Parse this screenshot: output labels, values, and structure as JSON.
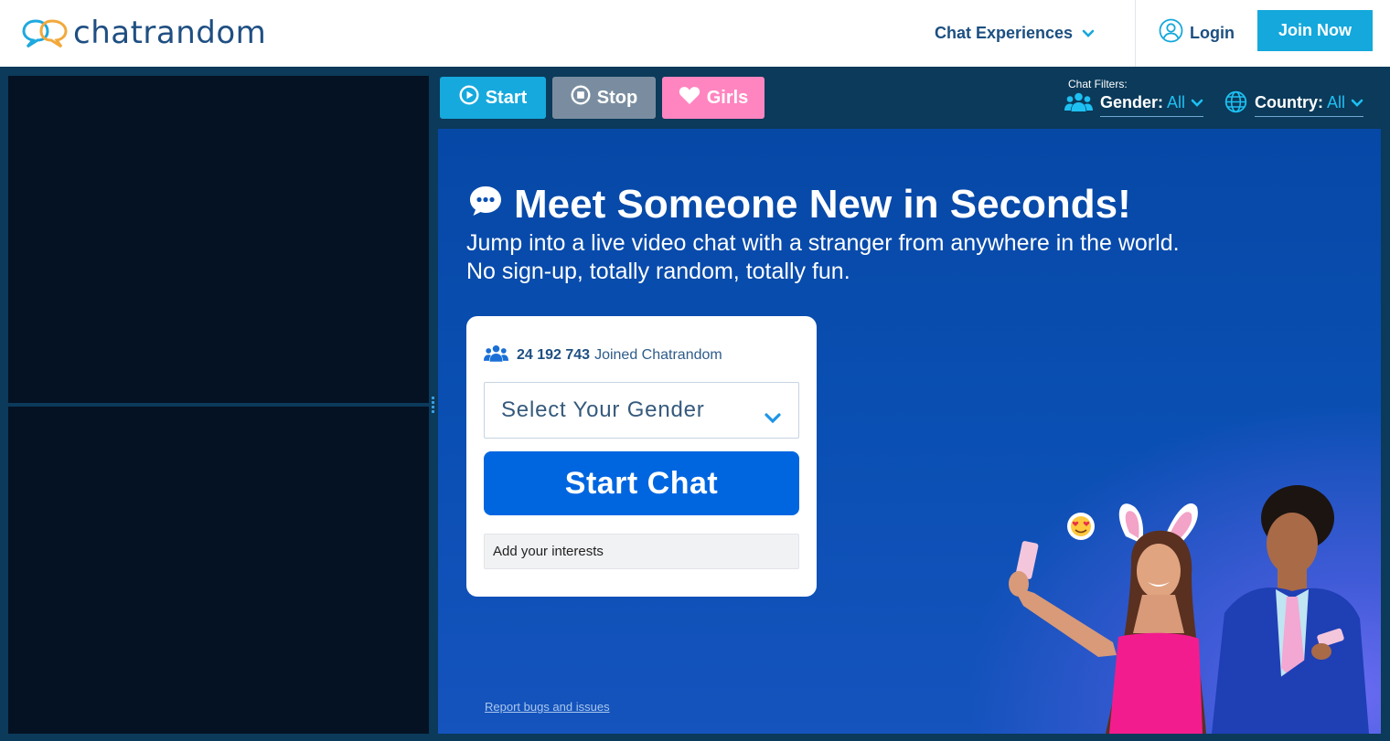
{
  "header": {
    "logo_text": "chatrandom",
    "nav_experiences": "Chat Experiences",
    "login": "Login",
    "join": "Join Now"
  },
  "toolbar": {
    "start": "Start",
    "stop": "Stop",
    "girls": "Girls",
    "filters_label": "Chat Filters:",
    "gender_key": "Gender:",
    "gender_value": "All",
    "country_key": "Country:",
    "country_value": "All"
  },
  "hero": {
    "title": "Meet Someone New in Seconds!",
    "subtitle": "Jump into a live video chat with a stranger from anywhere in the world. No sign-up, totally random, totally fun."
  },
  "card": {
    "joined_count": "24 192 743",
    "joined_text": "Joined Chatrandom",
    "gender_select": "Select Your Gender",
    "start_chat": "Start Chat",
    "interests_placeholder": "Add your interests"
  },
  "footer": {
    "report": "Report bugs and issues"
  },
  "colors": {
    "header_bg": "#ffffff",
    "page_bg": "#0b3a5a",
    "accent": "#16a9dd",
    "stop": "#7a8da0",
    "girls": "#ff85c0",
    "primary_button": "#0066e0",
    "hero_bg": "#0a4fb3"
  },
  "icons": {
    "logo": "chat-bubbles-logo-icon",
    "experiences_chevron": "chevron-down-icon",
    "login": "user-circle-icon",
    "start": "play-circle-icon",
    "stop": "stop-circle-icon",
    "girls": "heart-icon",
    "gender_filter": "users-icon",
    "country_filter": "globe-icon",
    "hero": "chat-bubble-icon",
    "joined": "users-icon"
  }
}
